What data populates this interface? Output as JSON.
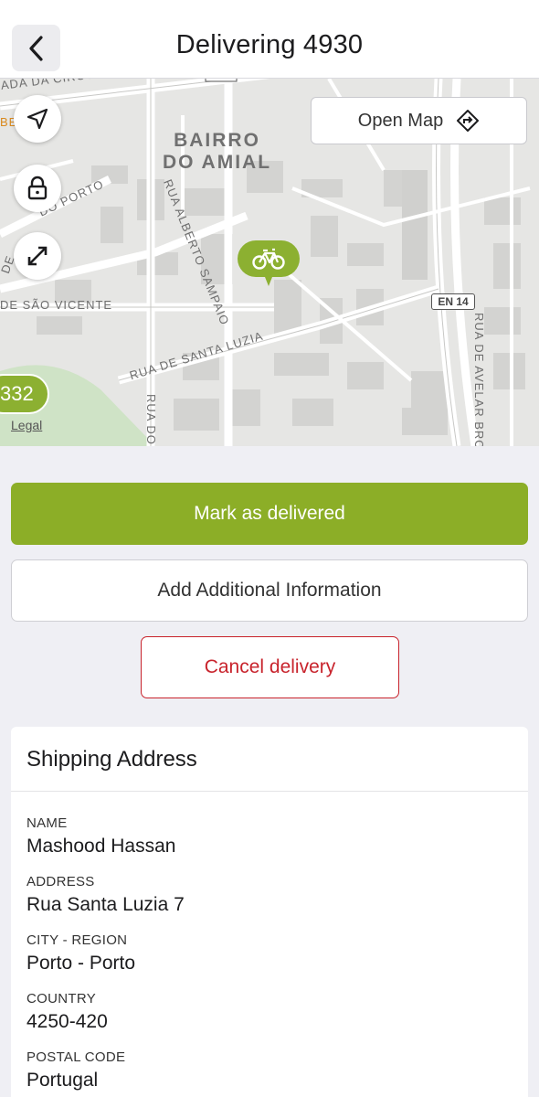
{
  "header": {
    "back_icon": "chevron-left-icon",
    "title": "Delivering 4930"
  },
  "map": {
    "open_map_label": "Open Map",
    "open_map_icon": "directions-icon",
    "district_line1": "BAIRRO",
    "district_line2": "DO AMIAL",
    "street_labels": {
      "circunvalacao": "ADA DA CIRCUNVALA",
      "porto": "DO PORTO",
      "alberto": "RUA ALBERTO SAMPAIO",
      "sao_vicente": "DE SÃO VICENTE",
      "santa_luzia": "RUA DE SANTA LUZIA",
      "rua_do": "RUA DO",
      "avelar": "RUA DE AVELAR BROTE",
      "edge_be": "BE",
      "edge_de": "DE"
    },
    "road_badge": "EN 14",
    "cluster_label": "332",
    "legal_label": "Legal",
    "controls": [
      "navigation-arrow-icon",
      "lock-icon",
      "expand-icon"
    ],
    "pin_icon": "bicycle-icon",
    "colors": {
      "pin": "#8cb031",
      "map_bg": "#e5e5e3",
      "park": "#cfe3c6"
    }
  },
  "actions": {
    "mark_delivered": "Mark as delivered",
    "add_info": "Add Additional Information",
    "cancel": "Cancel delivery"
  },
  "colors": {
    "primary": "#8cae27",
    "danger": "#c8232c"
  },
  "shipping": {
    "title": "Shipping Address",
    "fields": [
      {
        "label": "NAME",
        "value": "Mashood Hassan"
      },
      {
        "label": "ADDRESS",
        "value": "Rua Santa Luzia 7"
      },
      {
        "label": "CITY - REGION",
        "value": "Porto - Porto"
      },
      {
        "label": "COUNTRY",
        "value": "4250-420"
      },
      {
        "label": "POSTAL CODE",
        "value": "Portugal"
      }
    ]
  }
}
